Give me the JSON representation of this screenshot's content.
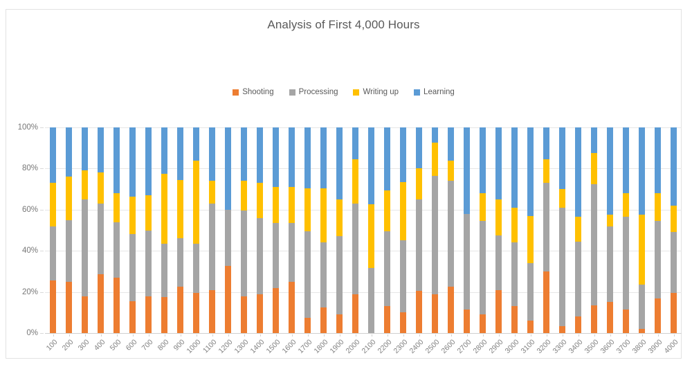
{
  "chart": {
    "title": "Analysis of First 4,000 Hours",
    "legend_position": "top-center",
    "grid": true,
    "axis_border_color": "#e2e2e2"
  },
  "legend": {
    "items": [
      {
        "label": "Shooting",
        "color": "#ED7D31"
      },
      {
        "label": "Processing",
        "color": "#A5A5A5"
      },
      {
        "label": "Writing up",
        "color": "#FFC000"
      },
      {
        "label": "Learning",
        "color": "#5B9BD5"
      }
    ]
  },
  "y_axis": {
    "ticks": [
      "0%",
      "20%",
      "40%",
      "60%",
      "80%",
      "100%"
    ],
    "values": [
      0,
      20,
      40,
      60,
      80,
      100
    ],
    "min": 0,
    "max": 100,
    "label": ""
  },
  "x_axis": {
    "label": "",
    "categories": [
      "100",
      "200",
      "300",
      "400",
      "500",
      "600",
      "700",
      "800",
      "900",
      "1000",
      "1100",
      "1200",
      "1300",
      "1400",
      "1500",
      "1600",
      "1700",
      "1800",
      "1900",
      "2000",
      "2100",
      "2200",
      "2300",
      "2400",
      "2500",
      "2600",
      "2700",
      "2800",
      "2900",
      "3000",
      "3100",
      "3200",
      "3300",
      "3400",
      "3500",
      "3600",
      "3700",
      "3800",
      "3900",
      "4000"
    ]
  },
  "chart_data": {
    "type": "bar",
    "stacked": true,
    "stack_mode": "percent",
    "title": "Analysis of First 4,000 Hours",
    "xlabel": "",
    "ylabel": "",
    "ylim": [
      0,
      100
    ],
    "grid": true,
    "legend_position": "top-center",
    "categories": [
      "100",
      "200",
      "300",
      "400",
      "500",
      "600",
      "700",
      "800",
      "900",
      "1000",
      "1100",
      "1200",
      "1300",
      "1400",
      "1500",
      "1600",
      "1700",
      "1800",
      "1900",
      "2000",
      "2100",
      "2200",
      "2300",
      "2400",
      "2500",
      "2600",
      "2700",
      "2800",
      "2900",
      "3000",
      "3100",
      "3200",
      "3300",
      "3400",
      "3500",
      "3600",
      "3700",
      "3800",
      "3900",
      "4000"
    ],
    "series": [
      {
        "name": "Shooting",
        "color": "#ED7D31",
        "values": [
          25.5,
          25,
          18,
          28.5,
          27,
          15.5,
          18,
          17.5,
          22.5,
          19.5,
          21,
          32.5,
          18,
          19,
          22,
          25,
          7.5,
          12.5,
          9,
          19,
          0,
          13,
          10,
          20.5,
          19,
          22.5,
          11.5,
          9,
          21,
          13,
          6,
          30,
          3.5,
          8,
          13.5,
          15,
          11.5,
          2,
          17,
          19.5
        ]
      },
      {
        "name": "Processing",
        "color": "#A5A5A5",
        "values": [
          26.5,
          30,
          47,
          34.5,
          27,
          32.5,
          32,
          26,
          23.5,
          24,
          42,
          27.5,
          41.5,
          37,
          31.5,
          28.5,
          42,
          31.5,
          38,
          44,
          31.5,
          36.5,
          35,
          44.5,
          57.5,
          51.5,
          46.5,
          45.5,
          26.5,
          31,
          28,
          43,
          57.5,
          36.5,
          59,
          37,
          45,
          21.5,
          37.5,
          29.5
        ]
      },
      {
        "name": "Writing up",
        "color": "#FFC000",
        "values": [
          21,
          21,
          14,
          15,
          14,
          18.5,
          17,
          34,
          28.5,
          40.5,
          11,
          0,
          14.5,
          17,
          17.5,
          17.5,
          21,
          26.5,
          18,
          21.5,
          31,
          20,
          28.5,
          15,
          16,
          10,
          0,
          13.5,
          17.5,
          17,
          23,
          11.5,
          9,
          12,
          15,
          5.5,
          11.5,
          34,
          13.5,
          13
        ]
      },
      {
        "name": "Learning",
        "color": "#5B9BD5",
        "values": [
          27,
          24,
          21,
          22,
          32,
          33.5,
          33,
          22.5,
          25.5,
          16,
          26,
          40,
          26,
          27,
          29,
          29,
          29.5,
          29.5,
          35,
          15.5,
          37.5,
          30.5,
          26.5,
          20,
          7.5,
          16,
          42,
          32,
          35,
          39,
          43,
          15.5,
          30,
          43.5,
          12.5,
          42.5,
          32,
          42.5,
          32,
          38
        ]
      }
    ]
  }
}
